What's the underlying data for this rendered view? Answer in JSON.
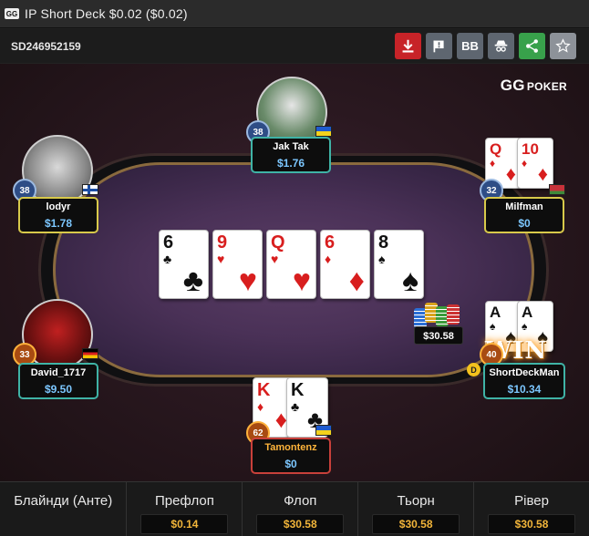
{
  "window": {
    "title": "IP  Short Deck $0.02 ($0.02)",
    "logo": "GG"
  },
  "toolbar": {
    "hand_id": "SD246952159",
    "buttons": [
      {
        "name": "download",
        "icon": "download-icon"
      },
      {
        "name": "report",
        "icon": "flag-icon"
      },
      {
        "name": "bb",
        "label": "BB"
      },
      {
        "name": "anonymous",
        "icon": "spy-icon"
      },
      {
        "name": "share",
        "icon": "share-icon"
      },
      {
        "name": "favorite",
        "icon": "star-icon"
      }
    ]
  },
  "brand": {
    "name": "GG",
    "suffix": "POKER"
  },
  "players": {
    "jaktak": {
      "name": "Jak Tak",
      "stack": "$1.76",
      "level": "38",
      "flag": "UA"
    },
    "lodyr": {
      "name": "lodyr",
      "stack": "$1.78",
      "level": "38",
      "flag": "FI"
    },
    "milfman": {
      "name": "Milfman",
      "stack": "$0",
      "level": "32",
      "flag": "BY",
      "cards": [
        {
          "rank": "Q",
          "suit": "♦"
        },
        {
          "rank": "10",
          "suit": "♦"
        }
      ]
    },
    "david": {
      "name": "David_1717",
      "stack": "$9.50",
      "level": "33",
      "flag": "DE"
    },
    "shortdeckman": {
      "name": "ShortDeckMan",
      "stack": "$10.34",
      "level": "40",
      "dealer": "D",
      "cards": [
        {
          "rank": "A",
          "suit": "♠"
        },
        {
          "rank": "A",
          "suit": "♠"
        }
      ],
      "win": "WIN"
    },
    "tamontenz": {
      "name": "Tamontenz",
      "stack": "$0",
      "level": "62",
      "flag": "UA",
      "cards": [
        {
          "rank": "K",
          "suit": "♦"
        },
        {
          "rank": "K",
          "suit": "♣"
        }
      ]
    }
  },
  "board": [
    {
      "rank": "6",
      "suit": "♣"
    },
    {
      "rank": "9",
      "suit": "♥"
    },
    {
      "rank": "Q",
      "suit": "♥"
    },
    {
      "rank": "6",
      "suit": "♦"
    },
    {
      "rank": "8",
      "suit": "♠"
    }
  ],
  "pot": "$30.58",
  "summary": [
    {
      "label": "Блайнди (Анте)",
      "value": ""
    },
    {
      "label": "Префлоп",
      "value": "$0.14"
    },
    {
      "label": "Флоп",
      "value": "$30.58"
    },
    {
      "label": "Тьорн",
      "value": "$30.58"
    },
    {
      "label": "Рівер",
      "value": "$30.58"
    }
  ],
  "colors": {
    "accent_teal": "#3fb3a6",
    "stack_blue": "#7cc7ff",
    "summary_gold": "#f2b53a",
    "felt": "#4a3157"
  }
}
